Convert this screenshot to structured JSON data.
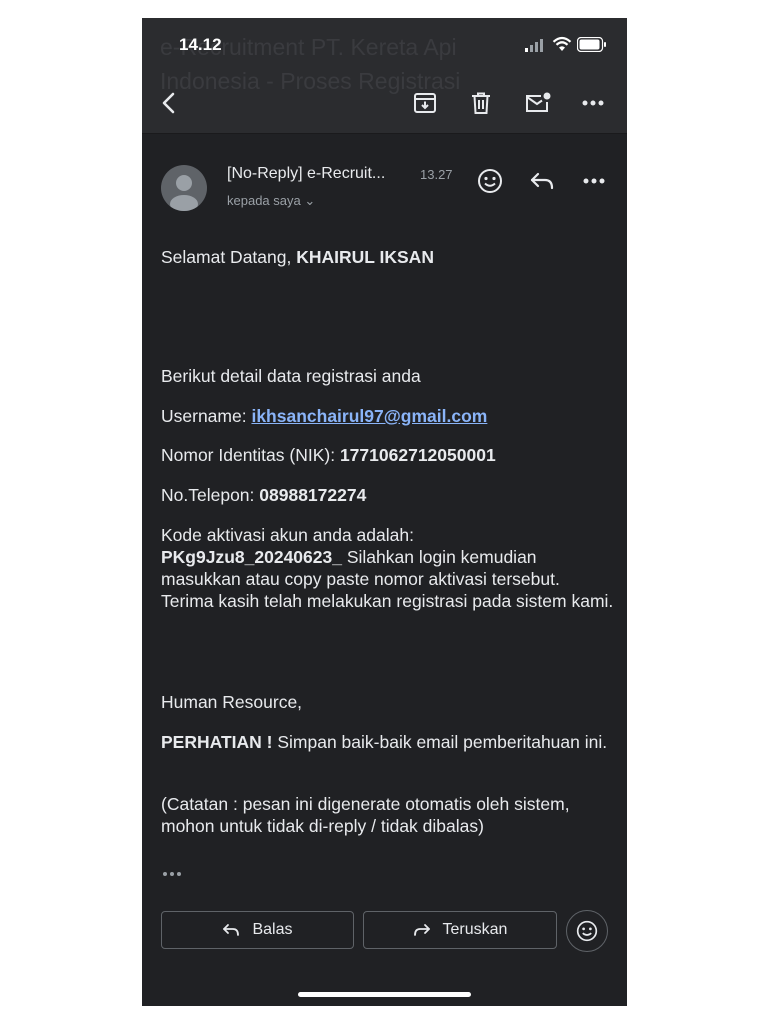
{
  "status_bar": {
    "time": "14.12"
  },
  "toolbar": {
    "subject_ghost": "e-Recruitment PT. Kereta Api\nIndonesia - Proses Registrasi",
    "icons": [
      "back-icon",
      "archive-icon",
      "delete-icon",
      "mark-unread-icon",
      "more-icon"
    ]
  },
  "message": {
    "sender": "[No-Reply] e-Recruit...",
    "time": "13.27",
    "recipient": "kepada saya ⌄"
  },
  "body": {
    "greeting_prefix": "Selamat Datang, ",
    "greeting_name": "KHAIRUL IKSAN",
    "intro": "Berikut detail data registrasi anda",
    "username_label": "Username: ",
    "username_value": "ikhsanchairul97@gmail.com",
    "nik_label": "Nomor Identitas (NIK): ",
    "nik_value": "1771062712050001",
    "phone_label": "No.Telepon: ",
    "phone_value": "08988172274",
    "activation_line": "Kode aktivasi akun anda adalah:",
    "activation_code": "PKg9Jzu8_20240623_",
    "activation_rest": " Silahkan login kemudian masukkan atau copy paste nomor aktivasi tersebut. Terima kasih telah melakukan registrasi pada sistem kami.",
    "signature": "Human Resource,",
    "warning_bold": "PERHATIAN !",
    "warning_rest": " Simpan baik-baik email pemberitahuan ini.",
    "note": "(Catatan : pesan ini digenerate otomatis oleh sistem, mohon untuk tidak di-reply / tidak dibalas)"
  },
  "actions": {
    "reply_label": "Balas",
    "forward_label": "Teruskan"
  },
  "colors": {
    "background": "#202124",
    "toolbar": "#2b2c2f",
    "link": "#8ab4f8",
    "text": "#e8eaed"
  }
}
